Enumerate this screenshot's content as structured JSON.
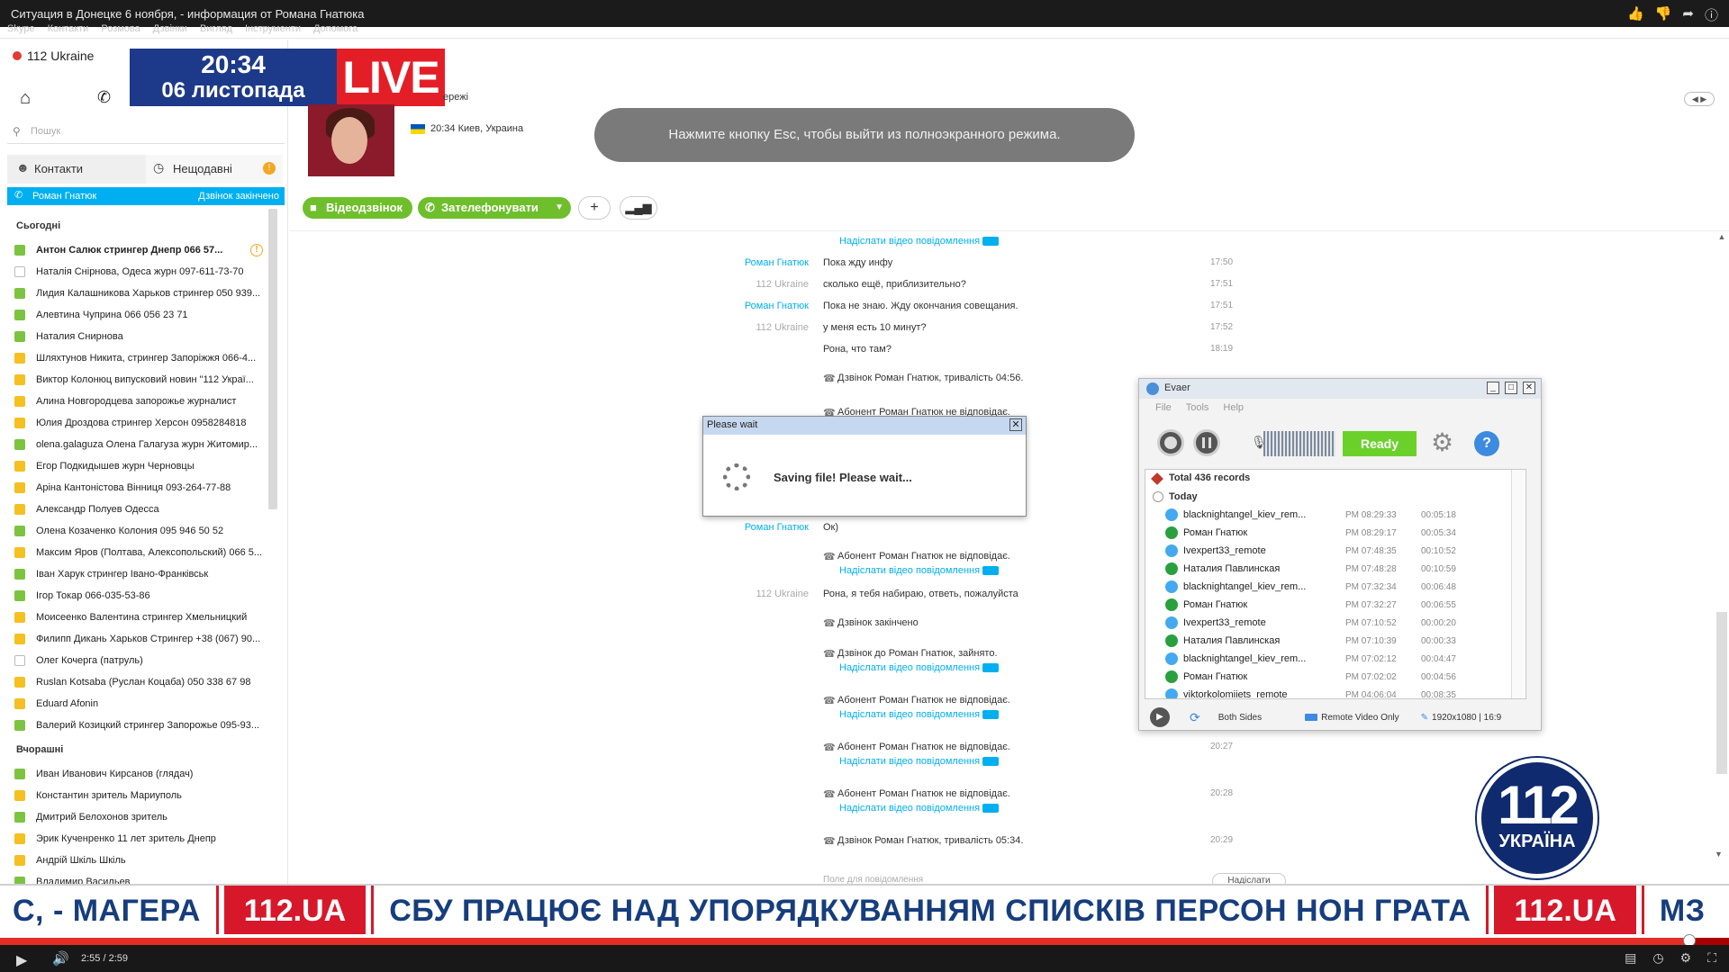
{
  "video": {
    "title": "Ситуация в Донецке 6 ноября, - информация от Романа Гнатюка",
    "icons": [
      "thumb-up-icon",
      "thumb-down-icon",
      "share-icon",
      "info-icon"
    ]
  },
  "skype_menu": [
    "Skype",
    "Контакти",
    "Розмова",
    "Дзвінки",
    "Вигляд",
    "Інструменти",
    "Допомога"
  ],
  "account": {
    "name": "112 Ukraine"
  },
  "search": {
    "placeholder": "Пошук"
  },
  "tabs": {
    "contacts": "Контакти",
    "recent": "Нещодавні",
    "recent_badge": "!"
  },
  "active_contact": {
    "name": "Роман Гнатюк",
    "status": "Дзвінок закінчено"
  },
  "contact_groups": [
    {
      "title": "Сьогодні",
      "items": [
        {
          "name": "Антон Салюк стрингер Днепр 066 57...",
          "status": "green",
          "bold": true,
          "warn": true
        },
        {
          "name": "Наталія Снірнова, Одеса журн 097-611-73-70",
          "status": "empty"
        },
        {
          "name": "Лидия Калашникова Харьков стрингер 050 939...",
          "status": "green"
        },
        {
          "name": "Алевтина Чуприна 066 056 23 71",
          "status": "green"
        },
        {
          "name": "Наталия Снирнова",
          "status": "green"
        },
        {
          "name": "Шляхтунов Никита, стрингер Запоріжжя 066-4...",
          "status": "yellow"
        },
        {
          "name": "Виктор Колонюц випусковий новин \"112 Украї...",
          "status": "yellow"
        },
        {
          "name": "Алина Новгородцева запорожье журналист",
          "status": "yellow"
        },
        {
          "name": "Юлия Дроздова стрингер Херсон 0958284818",
          "status": "yellow"
        },
        {
          "name": "olena.galaguza Олена Галагуза журн Житомир...",
          "status": "green"
        },
        {
          "name": "Егор Подкидышев журн Черновцы",
          "status": "yellow"
        },
        {
          "name": "Аріна Кантоністова Вінниця 093-264-77-88",
          "status": "yellow"
        },
        {
          "name": "Александр Полуев Одесса",
          "status": "yellow"
        },
        {
          "name": "Олена Козаченко Колония 095 946 50 52",
          "status": "green"
        },
        {
          "name": "Максим Яров (Полтава, Алексопольский) 066 5...",
          "status": "yellow"
        },
        {
          "name": "Іван Харук стрингер Івано-Франківськ",
          "status": "green"
        },
        {
          "name": "Ігор Токар 066-035-53-86",
          "status": "green"
        },
        {
          "name": "Моисеенко Валентина стрингер Хмельницкий",
          "status": "yellow"
        },
        {
          "name": "Филипп Дикань Харьков Стрингер +38 (067) 90...",
          "status": "yellow"
        },
        {
          "name": "Олег Кочерга (патруль)",
          "status": "empty"
        },
        {
          "name": "Ruslan Kotsaba (Руслан Коцаба) 050 338 67 98",
          "status": "yellow"
        },
        {
          "name": "Eduard Afonin",
          "status": "yellow"
        },
        {
          "name": "Валерий Козицкий стрингер Запорожье 095-93...",
          "status": "green"
        }
      ]
    },
    {
      "title": "Вчорашні",
      "items": [
        {
          "name": "Иван Иванович Кирсанов (глядач)",
          "status": "green"
        },
        {
          "name": "Константин зритель Мариуполь",
          "status": "yellow"
        },
        {
          "name": "Дмитрий Белохонов зритель",
          "status": "green"
        },
        {
          "name": "Эрик Кученренко 11 лет зритель Днепр",
          "status": "yellow"
        },
        {
          "name": "Андрій Шкіль Шкіль",
          "status": "yellow"
        },
        {
          "name": "Владимир Васильев",
          "status": "green"
        }
      ]
    }
  ],
  "live": {
    "time": "20:34",
    "date": "06 листопада",
    "label": "LIVE"
  },
  "profile": {
    "network": "ережі",
    "location": "20:34 Киев, Украина"
  },
  "fullscreen_notice": "Нажмите кнопку Esc, чтобы выйти из полноэкранного режима.",
  "actions": {
    "video_call": "Відеодзвінок",
    "call": "Зателефонувати",
    "add": "+",
    "signal": "signal-icon"
  },
  "chat": [
    {
      "sender": "",
      "text": "",
      "link": "Надіслати відео повідомлення",
      "time": ""
    },
    {
      "sender": "Роман Гнатюк",
      "self": false,
      "text": "Пока жду инфу",
      "time": "17:50"
    },
    {
      "sender": "112 Ukraine",
      "self": true,
      "text": "сколько ещё, приблизительно?",
      "time": "17:51"
    },
    {
      "sender": "Роман Гнатюк",
      "self": false,
      "text": "Пока не знаю. Жду окончания совещания.",
      "time": "17:51"
    },
    {
      "sender": "112 Ukraine",
      "self": true,
      "text": "у меня есть 10 минут?",
      "time": "17:52"
    },
    {
      "sender": "",
      "text": "Рона, что там?",
      "time": "18:19"
    },
    {
      "sender": "",
      "call": true,
      "text": "Дзвінок Роман Гнатюк, тривалість 04:56.",
      "time": ""
    },
    {
      "sender": "",
      "call": true,
      "text": "Абонент Роман Гнатюк не відповідає.",
      "time": ""
    },
    {
      "sender": "Роман Гнатюк",
      "self": false,
      "text": "Ок)",
      "time": ""
    },
    {
      "sender": "",
      "call": true,
      "text": "Абонент Роман Гнатюк не відповідає.",
      "link": "Надіслати відео повідомлення",
      "time": ""
    },
    {
      "sender": "112 Ukraine",
      "self": true,
      "text": "Рона, я тебя набираю, ответь, пожалуйста",
      "time": ""
    },
    {
      "sender": "",
      "call": true,
      "text": "Дзвінок закінчено",
      "time": ""
    },
    {
      "sender": "",
      "call": true,
      "text": "Дзвінок до Роман Гнатюк, зайнято.",
      "link": "Надіслати відео повідомлення",
      "time": ""
    },
    {
      "sender": "",
      "call": true,
      "text": "Абонент Роман Гнатюк не відповідає.",
      "link": "Надіслати відео повідомлення",
      "time": ""
    },
    {
      "sender": "",
      "call": true,
      "text": "Абонент Роман Гнатюк не відповідає.",
      "link": "Надіслати відео повідомлення",
      "time": "20:27"
    },
    {
      "sender": "",
      "call": true,
      "text": "Абонент Роман Гнатюк не відповідає.",
      "link": "Надіслати відео повідомлення",
      "time": "20:28"
    },
    {
      "sender": "",
      "call": true,
      "text": "Дзвінок Роман Гнатюк, тривалість 05:34.",
      "time": "20:29"
    }
  ],
  "chat_input": {
    "placeholder": "Поле для повідомлення",
    "send": "Надіслати"
  },
  "wait_dialog": {
    "title": "Please wait",
    "message": "Saving file! Please wait..."
  },
  "evaer": {
    "title": "Evaer",
    "menu": [
      "File",
      "Tools",
      "Help"
    ],
    "status": "Ready",
    "help": "?",
    "total": "Total 436 records",
    "today": "Today",
    "records": [
      {
        "name": "blacknightangel_kiev_rem...",
        "time": "PM 08:29:33",
        "duration": "00:05:18",
        "type": "blue"
      },
      {
        "name": "Роман Гнатюк",
        "time": "PM 08:29:17",
        "duration": "00:05:34",
        "type": "green"
      },
      {
        "name": "Ivexpert33_remote",
        "time": "PM 07:48:35",
        "duration": "00:10:52",
        "type": "blue"
      },
      {
        "name": "Наталия Павлинская",
        "time": "PM 07:48:28",
        "duration": "00:10:59",
        "type": "green"
      },
      {
        "name": "blacknightangel_kiev_rem...",
        "time": "PM 07:32:34",
        "duration": "00:06:48",
        "type": "blue"
      },
      {
        "name": "Роман Гнатюк",
        "time": "PM 07:32:27",
        "duration": "00:06:55",
        "type": "green"
      },
      {
        "name": "Ivexpert33_remote",
        "time": "PM 07:10:52",
        "duration": "00:00:20",
        "type": "blue"
      },
      {
        "name": "Наталия Павлинская",
        "time": "PM 07:10:39",
        "duration": "00:00:33",
        "type": "green"
      },
      {
        "name": "blacknightangel_kiev_rem...",
        "time": "PM 07:02:12",
        "duration": "00:04:47",
        "type": "blue"
      },
      {
        "name": "Роман Гнатюк",
        "time": "PM 07:02:02",
        "duration": "00:04:56",
        "type": "green"
      },
      {
        "name": "viktorkolomiiets_remote",
        "time": "PM 04:06:04",
        "duration": "00:08:35",
        "type": "blue"
      }
    ],
    "footer": {
      "sides": "Both Sides",
      "mode": "Remote Video Only",
      "resolution": "1920x1080 | 16:9"
    }
  },
  "channel_logo": {
    "number": "112",
    "sub": "УКРАЇНА"
  },
  "ticker": [
    {
      "kind": "text",
      "value": "С, - МАГЕРА"
    },
    {
      "kind": "brand",
      "value": "112.UA"
    },
    {
      "kind": "text",
      "value": "СБУ ПРАЦЮЄ НАД УПОРЯДКУВАННЯМ СПИСКІВ ПЕРСОН НОН ГРАТА"
    },
    {
      "kind": "brand",
      "value": "112.UA"
    },
    {
      "kind": "text",
      "value": "МЗ"
    }
  ],
  "player": {
    "time": "2:55 / 2:59",
    "progress": 0.977
  },
  "colors": {
    "skype_blue": "#00aff0",
    "live_red": "#e41e26",
    "brand_navy": "#163d7d",
    "ticker_red": "#d7182a"
  }
}
